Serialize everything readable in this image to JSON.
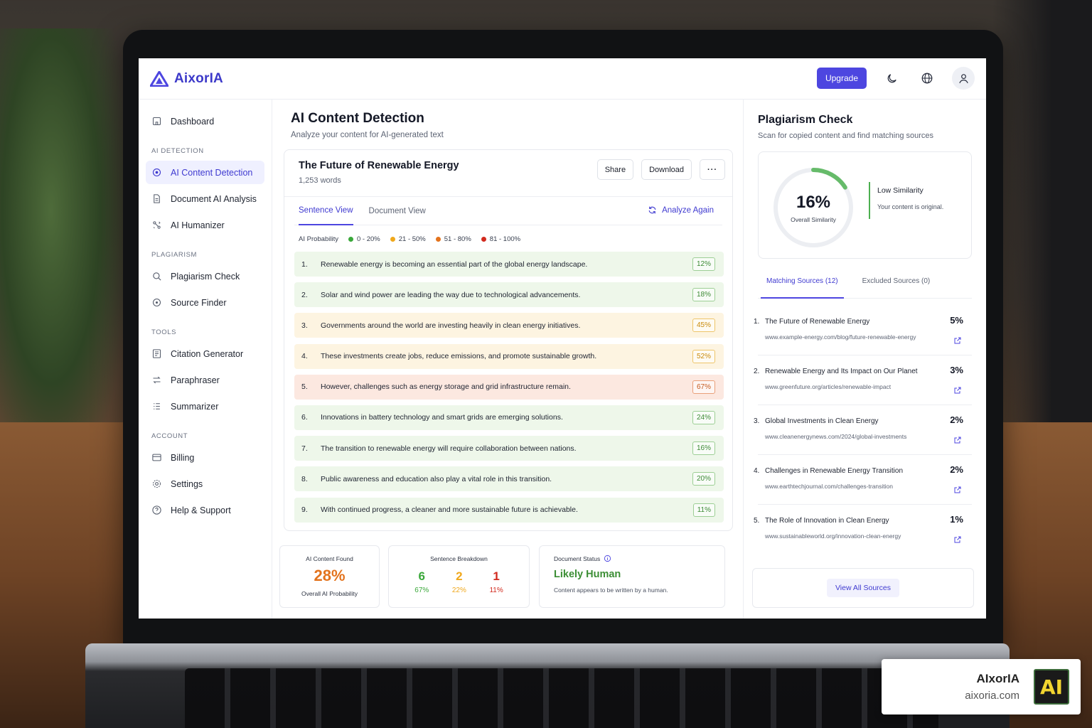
{
  "app": {
    "name": "AixorIA"
  },
  "topbar": {
    "upgrade_label": "Upgrade"
  },
  "sidebar": {
    "dashboard": "Dashboard",
    "sections": [
      {
        "title": "AI DETECTION",
        "items": [
          "AI Content Detection",
          "Document AI Analysis",
          "AI Humanizer"
        ]
      },
      {
        "title": "PLAGIARISM",
        "items": [
          "Plagiarism Check",
          "Source Finder"
        ]
      },
      {
        "title": "TOOLS",
        "items": [
          "Citation Generator",
          "Paraphraser",
          "Summarizer"
        ]
      },
      {
        "title": "ACCOUNT",
        "items": [
          "Billing",
          "Settings",
          "Help & Support"
        ]
      }
    ],
    "active_item": "AI Content Detection"
  },
  "main": {
    "title": "AI Content Detection",
    "subtitle": "Analyze your content for AI-generated text",
    "document": {
      "title": "The Future of Renewable Energy",
      "word_count": "1,253 words",
      "share_label": "Share",
      "download_label": "Download",
      "more_label": "···"
    },
    "tabs": [
      "Sentence View",
      "Document View"
    ],
    "active_tab": "Sentence View",
    "analyze_again": "Analyze Again",
    "legend": {
      "label": "AI Probability",
      "ranges": [
        {
          "label": "0 - 20%",
          "color": "#3aa83a"
        },
        {
          "label": "21 - 50%",
          "color": "#f0a81c"
        },
        {
          "label": "51 - 80%",
          "color": "#e4731d"
        },
        {
          "label": "81 - 100%",
          "color": "#d22a1e"
        }
      ]
    },
    "sentences": [
      {
        "num": "1.",
        "text": "Renewable energy is becoming an essential part of the global energy landscape.",
        "score": "12%",
        "level": "low"
      },
      {
        "num": "2.",
        "text": "Solar and wind power are leading the way due to technological advancements.",
        "score": "18%",
        "level": "low"
      },
      {
        "num": "3.",
        "text": "Governments around the world are investing heavily in clean energy initiatives.",
        "score": "45%",
        "level": "mid"
      },
      {
        "num": "4.",
        "text": "These investments create jobs, reduce emissions, and promote sustainable growth.",
        "score": "52%",
        "level": "mid"
      },
      {
        "num": "5.",
        "text": "However, challenges such as energy storage and grid infrastructure remain.",
        "score": "67%",
        "level": "high"
      },
      {
        "num": "6.",
        "text": "Innovations in battery technology and smart grids are emerging solutions.",
        "score": "24%",
        "level": "low"
      },
      {
        "num": "7.",
        "text": "The transition to renewable energy will require collaboration between nations.",
        "score": "16%",
        "level": "low"
      },
      {
        "num": "8.",
        "text": "Public awareness and education also play a vital role in this transition.",
        "score": "20%",
        "level": "low"
      },
      {
        "num": "9.",
        "text": "With continued progress, a cleaner and more sustainable future is achievable.",
        "score": "11%",
        "level": "low"
      }
    ],
    "stats": {
      "ai_found": {
        "label": "AI Content Found",
        "value": "28%",
        "note": "Overall AI Probability"
      },
      "breakdown": {
        "label": "Sentence Breakdown",
        "items": [
          {
            "count": "6",
            "pct": "67%",
            "color": "#3aa83a"
          },
          {
            "count": "2",
            "pct": "22%",
            "color": "#f0a81c"
          },
          {
            "count": "1",
            "pct": "11%",
            "color": "#d22a1e"
          }
        ]
      },
      "status": {
        "label": "Document Status",
        "value": "Likely Human",
        "note": "Content appears to be written by a human."
      }
    }
  },
  "plagiarism": {
    "title": "Plagiarism Check",
    "subtitle": "Scan for copied content and find matching sources",
    "similarity": {
      "value": "16%",
      "fraction": 0.16,
      "caption": "Overall Similarity",
      "level": "Low Similarity",
      "description": "Your content is original."
    },
    "tabs": [
      "Matching Sources (12)",
      "Excluded Sources (0)"
    ],
    "sources": [
      {
        "num": "1.",
        "title": "The Future of Renewable Energy",
        "url": "www.example-energy.com/blog/future-renewable-energy",
        "pct": "5%"
      },
      {
        "num": "2.",
        "title": "Renewable Energy and Its Impact on Our Planet",
        "url": "www.greenfuture.org/articles/renewable-impact",
        "pct": "3%"
      },
      {
        "num": "3.",
        "title": "Global Investments in Clean Energy",
        "url": "www.cleanenergynews.com/2024/global-investments",
        "pct": "2%"
      },
      {
        "num": "4.",
        "title": "Challenges in Renewable Energy Transition",
        "url": "www.earthtechjournal.com/challenges-transition",
        "pct": "2%"
      },
      {
        "num": "5.",
        "title": "The Role of Innovation in Clean Energy",
        "url": "www.sustainableworld.org/innovation-clean-energy",
        "pct": "1%"
      }
    ],
    "view_all": "View All Sources"
  },
  "watermark": {
    "name": "AIxorIA",
    "url": "aixoria.com",
    "logo_text": "AI"
  }
}
